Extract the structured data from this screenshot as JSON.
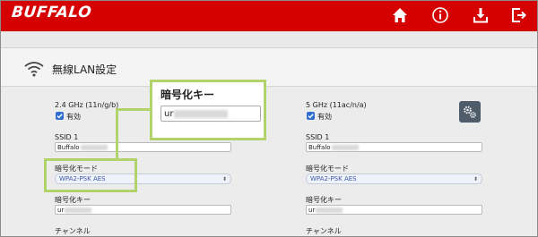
{
  "header": {
    "logo": "BUFFALO",
    "icons": [
      "home-icon",
      "info-icon",
      "download-icon",
      "logout-icon"
    ],
    "brand_color": "#d50000"
  },
  "page": {
    "title": "無線LAN設定"
  },
  "band_24": {
    "band_label": "2.4 GHz (11n/g/b)",
    "enabled_label": "有効",
    "ssid_label": "SSID 1",
    "ssid_value": "Buffalo",
    "encryption_mode_label": "暗号化モード",
    "encryption_mode_value": "WPA2-PSK AES",
    "encryption_key_label": "暗号化キー",
    "encryption_key_value": "ur",
    "channel_label": "チャンネル"
  },
  "band_5": {
    "band_label": "5 GHz (11ac/n/a)",
    "enabled_label": "有効",
    "ssid_label": "SSID 1",
    "ssid_value": "Buffalo",
    "encryption_mode_label": "暗号化モード",
    "encryption_mode_value": "WPA2-PSK AES",
    "encryption_key_label": "暗号化キー",
    "encryption_key_value": "ur",
    "channel_label": "チャンネル"
  },
  "callout": {
    "title": "暗号化キー",
    "key_value": "ur",
    "highlight_color": "#b2d26a"
  }
}
